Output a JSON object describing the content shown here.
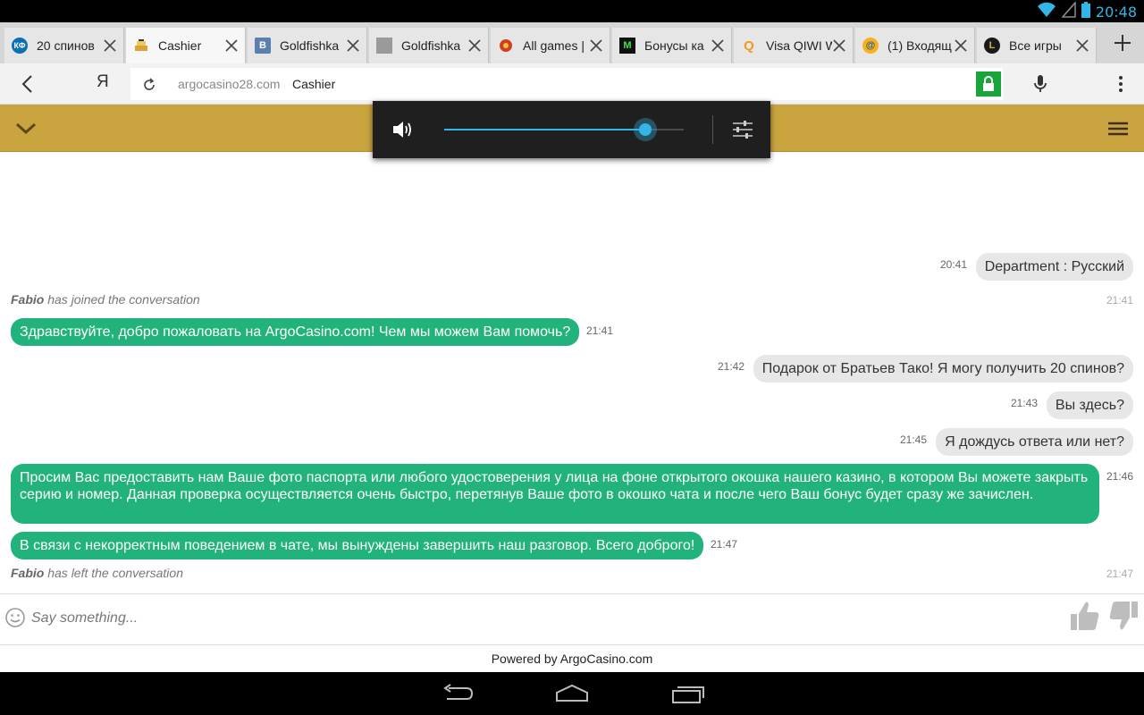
{
  "status": {
    "time": "20:48"
  },
  "tabs": [
    {
      "title": "20 спинов",
      "favicon": "КФ",
      "favicon_bg": "#0a6fb5",
      "favicon_color": "#ffffff"
    },
    {
      "title": "Cashier",
      "favicon": "",
      "favicon_bg": "#d9a43a",
      "favicon_color": "#ffffff"
    },
    {
      "title": "Goldfishka",
      "favicon": "B",
      "favicon_bg": "#5a7fb1",
      "favicon_color": "#ffffff"
    },
    {
      "title": "Goldfishka",
      "favicon": "",
      "favicon_bg": "#9a9a9a",
      "favicon_color": "#ffffff"
    },
    {
      "title": "All games |",
      "favicon": "✹",
      "favicon_bg": "#e6e6e6",
      "favicon_color": "#d04020"
    },
    {
      "title": "Бонусы ка",
      "favicon": "M",
      "favicon_bg": "#111111",
      "favicon_color": "#4be04b"
    },
    {
      "title": "Visa QIWI W",
      "favicon": "Q",
      "favicon_bg": "#e6e6e6",
      "favicon_color": "#f29a1d"
    },
    {
      "title": "(1) Входящ",
      "favicon": "@",
      "favicon_bg": "#f7b21a",
      "favicon_color": "#1a5fa8"
    },
    {
      "title": "Все игры",
      "favicon": "L",
      "favicon_bg": "#1a1a1a",
      "favicon_color": "#d0b040"
    }
  ],
  "toolbar": {
    "ya_label": "Я",
    "url_domain": "argocasino28.com",
    "url_title": "Cashier"
  },
  "volume": {
    "level": 0.84
  },
  "chat": {
    "messages": [
      {
        "kind": "user",
        "time": "20:41",
        "text": "Department : Русский"
      },
      {
        "kind": "system",
        "name": "Fabio",
        "text": " has joined the conversation",
        "time": "21:41"
      },
      {
        "kind": "agent",
        "time": "21:41",
        "text": "Здравствуйте, добро пожаловать на ArgoCasino.com! Чем мы можем Вам помочь?"
      },
      {
        "kind": "user",
        "time": "21:42",
        "text": "Подарок от Братьев Тако! Я могу получить 20 спинов?"
      },
      {
        "kind": "user",
        "time": "21:43",
        "text": "Вы здесь?"
      },
      {
        "kind": "user",
        "time": "21:45",
        "text": "Я дождусь ответа или нет?"
      },
      {
        "kind": "agent",
        "time": "21:46",
        "text": "Просим Вас предоставить нам Ваше фото паспорта или любого удостоверения у лица на фоне открытого окошка нашего казино, в котором Вы можете закрыть серию и номер. Данная проверка осуществляется очень быстро, перетянув Ваше фото в окошко чата и после чего Ваш бонус будет сразу же зачислен."
      },
      {
        "kind": "agent",
        "time": "21:47",
        "text": "В связи с некорректным поведением в чате, мы вынуждены завершить наш разговор. Всего доброго!"
      },
      {
        "kind": "system",
        "name": "Fabio",
        "text": " has left the conversation",
        "time": "21:47"
      }
    ],
    "input_placeholder": "Say something...",
    "powered_by": "Powered by ArgoCasino.com"
  },
  "colors": {
    "accent": "#33b5e5",
    "agent_bubble": "#22b37c",
    "site_header": "#c9a43f",
    "lock": "#1aa53a"
  }
}
